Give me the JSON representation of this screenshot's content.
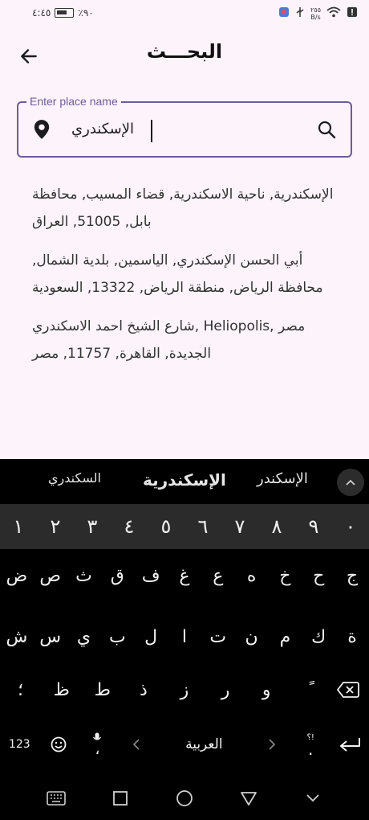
{
  "status_bar": {
    "time": "٤:٤٥",
    "battery": "٪٩٠",
    "net_speed_value": "٢٥٥",
    "net_speed_unit": "B/s"
  },
  "app_bar": {
    "title": "البحـــث"
  },
  "search": {
    "label": "Enter place name",
    "value": "الإسكندري"
  },
  "results": [
    "الإسكندرية, ناحية الاسكندرية, قضاء المسيب, محافظة بابل, 51005, العراق",
    "أبي الحسن الإسكندري, الياسمين, بلدية الشمال, محافظة الرياض, منطقة الرياض, 13322, السعودية",
    "شارع الشيخ احمد الاسكندري, Heliopolis, مصر الجديدة, القاهرة, 11757, مصر"
  ],
  "keyboard": {
    "suggestions": [
      "السكندري",
      "الإسكندرية",
      "الإسكندر"
    ],
    "number_row": [
      "١",
      "٢",
      "٣",
      "٤",
      "٥",
      "٦",
      "٧",
      "٨",
      "٩",
      "٠"
    ],
    "row1": [
      "ض",
      "ص",
      "ث",
      "ق",
      "ف",
      "غ",
      "ع",
      "ه",
      "خ",
      "ح",
      "ج"
    ],
    "row2": [
      "ش",
      "س",
      "ي",
      "ب",
      "ل",
      "ا",
      "ت",
      "ن",
      "م",
      "ك",
      "ة"
    ],
    "row3": [
      "؛",
      "ظ",
      "ط",
      "ذ",
      "ز",
      "ر",
      "و",
      "ً"
    ],
    "symbols_key": "123",
    "comma_key": "،",
    "space_label": "العربية",
    "punct_key": "؟!",
    "period_key": "."
  },
  "colors": {
    "background": "#fcf3fb",
    "accent": "#6f5b9a",
    "keyboard_bg": "#000000",
    "number_row_bg": "#2b2b2b"
  }
}
